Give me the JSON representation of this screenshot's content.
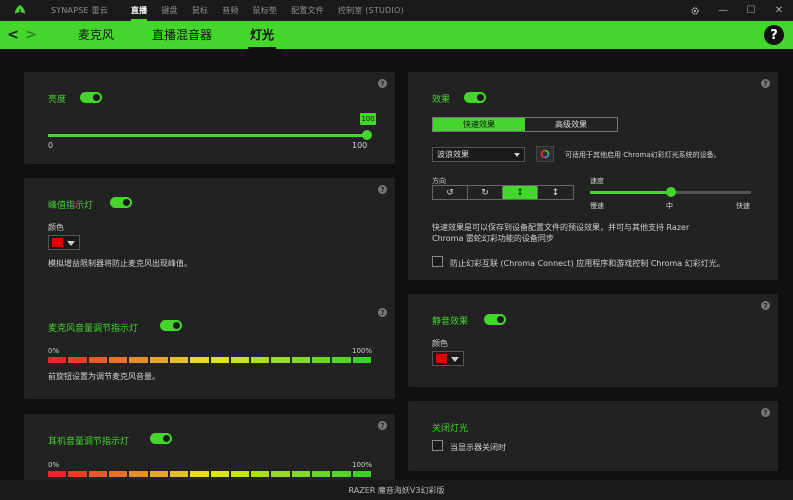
{
  "topnav": {
    "items": [
      "SYNAPSE 雷云",
      "直播",
      "键盘",
      "鼠标",
      "音频",
      "鼠标垫",
      "配置文件",
      "控制室 (STUDIO)"
    ],
    "active_index": 1
  },
  "subnav": {
    "back": "<",
    "forward": ">",
    "tabs": [
      "麦克风",
      "直播混音器",
      "灯光"
    ],
    "active_index": 2,
    "help": "?"
  },
  "window": {
    "settings_icon": "gear-icon",
    "minimize": "—",
    "maximize": "☐",
    "close": "✕"
  },
  "brightness": {
    "label": "亮度",
    "enabled": true,
    "value": "100",
    "min": "0",
    "max": "100",
    "level": 1.0
  },
  "peak": {
    "label": "峰值指示灯",
    "enabled": true,
    "color_label": "颜色",
    "color": "#e30000",
    "description": "模拟增益限制器将防止麦克风出现峰值。"
  },
  "mic_volume": {
    "label": "麦克风音量调节指示灯",
    "enabled": true,
    "min": "0%",
    "max": "100%",
    "description": "前旋钮设置为调节麦克风音量。"
  },
  "headphone_volume": {
    "label": "耳机音量调节指示灯",
    "enabled": true,
    "min": "0%",
    "max": "100%"
  },
  "effects": {
    "label": "效果",
    "enabled": true,
    "tabs": [
      "快速效果",
      "高级效果"
    ],
    "active_tab": 0,
    "effect_value": "波浪效果",
    "chroma_note": "可适用于其他启用 Chroma幻彩灯光系统的设备。",
    "direction_label": "方向",
    "directions": [
      "↺",
      "↻",
      "↕",
      "↕"
    ],
    "active_direction": 2,
    "speed_label": "速度",
    "speed_slow": "慢速",
    "speed_mid": "中",
    "speed_fast": "快速",
    "speed_level": 0.5,
    "description": "快速效果是可以保存到设备配置文件的预设效果，并可与其他支持 Razer Chroma 雷蛇幻彩功能的设备同步",
    "connect_label": "防止幻彩互联 (Chroma Connect) 应用程序和游戏控制 Chroma 幻彩灯光。",
    "connect_checked": false
  },
  "mute": {
    "label": "静音效果",
    "enabled": true,
    "color_label": "颜色",
    "color": "#e30000"
  },
  "lights_off": {
    "label": "关闭灯光",
    "option_label": "当显示器关闭时",
    "checked": false
  },
  "status": {
    "device": "RAZER 魔音海妖V3幻彩版"
  },
  "colors": {
    "accent": "#44d62c",
    "panel": "#222222",
    "background": "#101010"
  }
}
